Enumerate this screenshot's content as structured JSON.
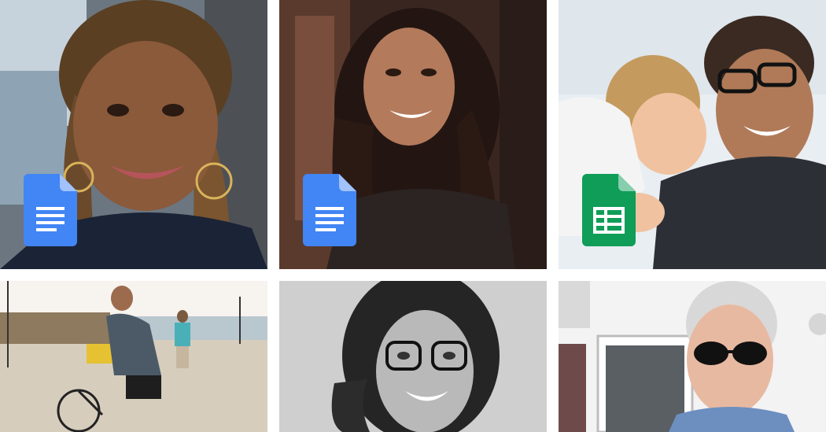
{
  "gallery": {
    "tiles": [
      {
        "subject": "woman-with-locs-and-hoop-earrings",
        "badge": "docs-icon",
        "badge_color": "#4285F4"
      },
      {
        "subject": "woman-with-dark-wavy-hair",
        "badge": "docs-icon",
        "badge_color": "#4285F4"
      },
      {
        "subject": "man-with-glasses-and-child",
        "badge": "sheets-icon",
        "badge_color": "#0F9D58"
      },
      {
        "subject": "man-on-bicycle-at-beach",
        "badge": null
      },
      {
        "subject": "woman-with-glasses-grayscale",
        "badge": null
      },
      {
        "subject": "man-with-sunglasses",
        "badge": null
      }
    ]
  }
}
